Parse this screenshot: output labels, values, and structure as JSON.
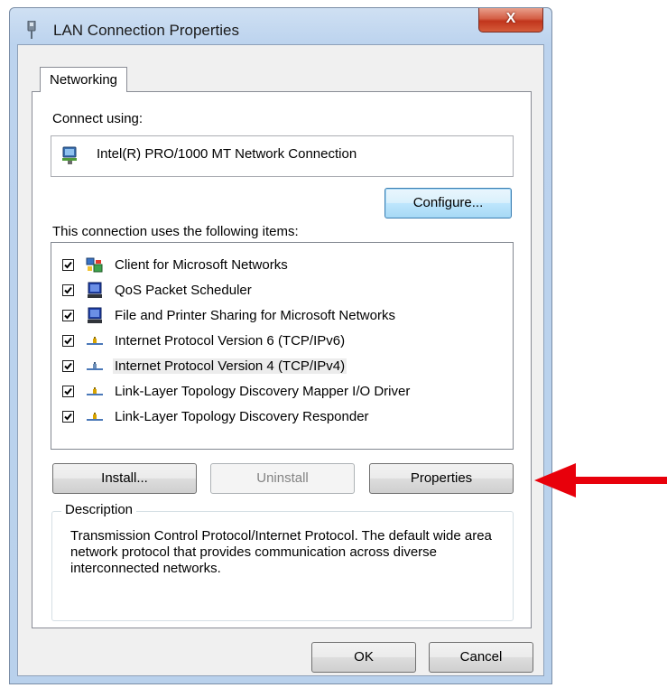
{
  "window": {
    "title": "LAN Connection Properties",
    "close_glyph": "X"
  },
  "tabs": [
    {
      "label": "Networking",
      "selected": true
    }
  ],
  "connect_using": {
    "label": "Connect using:",
    "adapter_name": "Intel(R) PRO/1000 MT Network Connection",
    "adapter_icon": "network-adapter-icon"
  },
  "buttons": {
    "configure": "Configure...",
    "install": "Install...",
    "uninstall": "Uninstall",
    "properties": "Properties",
    "ok": "OK",
    "cancel": "Cancel"
  },
  "items_label": "This connection uses the following items:",
  "items": [
    {
      "label": "Client for Microsoft Networks",
      "checked": true,
      "icon": "network-client-icon"
    },
    {
      "label": "QoS Packet Scheduler",
      "checked": true,
      "icon": "service-monitor-icon"
    },
    {
      "label": "File and Printer Sharing for Microsoft Networks",
      "checked": true,
      "icon": "service-monitor-icon"
    },
    {
      "label": "Internet Protocol Version 6 (TCP/IPv6)",
      "checked": true,
      "icon": "protocol-icon"
    },
    {
      "label": "Internet Protocol Version 4 (TCP/IPv4)",
      "checked": true,
      "icon": "protocol-icon",
      "selected": true
    },
    {
      "label": "Link-Layer Topology Discovery Mapper I/O Driver",
      "checked": true,
      "icon": "protocol-icon"
    },
    {
      "label": "Link-Layer Topology Discovery Responder",
      "checked": true,
      "icon": "protocol-icon"
    }
  ],
  "description": {
    "legend": "Description",
    "text": "Transmission Control Protocol/Internet Protocol. The default wide area network protocol that provides communication across diverse interconnected networks."
  },
  "annotation": {
    "arrow_color": "#e8000b",
    "arrow_icon": "red-arrow-icon"
  },
  "colors": {
    "title_bar": "#b9d1ec",
    "close_button": "#c1351c",
    "focus_button_border": "#3c7fb1"
  }
}
